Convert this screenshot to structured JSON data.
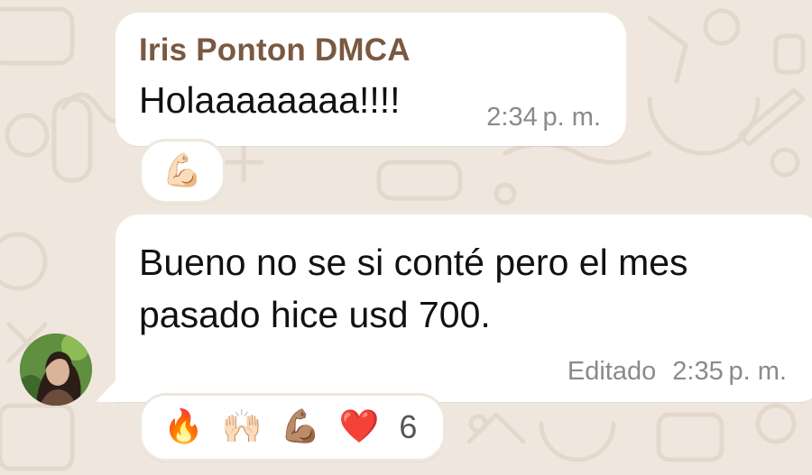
{
  "messages": [
    {
      "sender": "Iris Ponton DMCA",
      "text": "Holaaaaaaaa!!!!",
      "time": "2:34 p. m.",
      "reactions": [
        {
          "emoji": "💪🏻",
          "icon": "flexed-biceps-light-icon"
        }
      ]
    },
    {
      "text": "Bueno no se si conté pero el mes pasado hice usd 700.",
      "edited_label": "Editado",
      "time": "2:35 p. m.",
      "reactions": [
        {
          "emoji": "🔥",
          "icon": "fire-icon"
        },
        {
          "emoji": "🙌🏻",
          "icon": "raising-hands-icon"
        },
        {
          "emoji": "💪🏽",
          "icon": "flexed-biceps-medium-icon"
        },
        {
          "emoji": "❤️",
          "icon": "red-heart-icon"
        }
      ],
      "reaction_count": "6"
    }
  ],
  "colors": {
    "sender": "#7a5941",
    "wallpaper": "#efe7de",
    "bubble": "#ffffff",
    "meta": "#8a8a8a"
  }
}
